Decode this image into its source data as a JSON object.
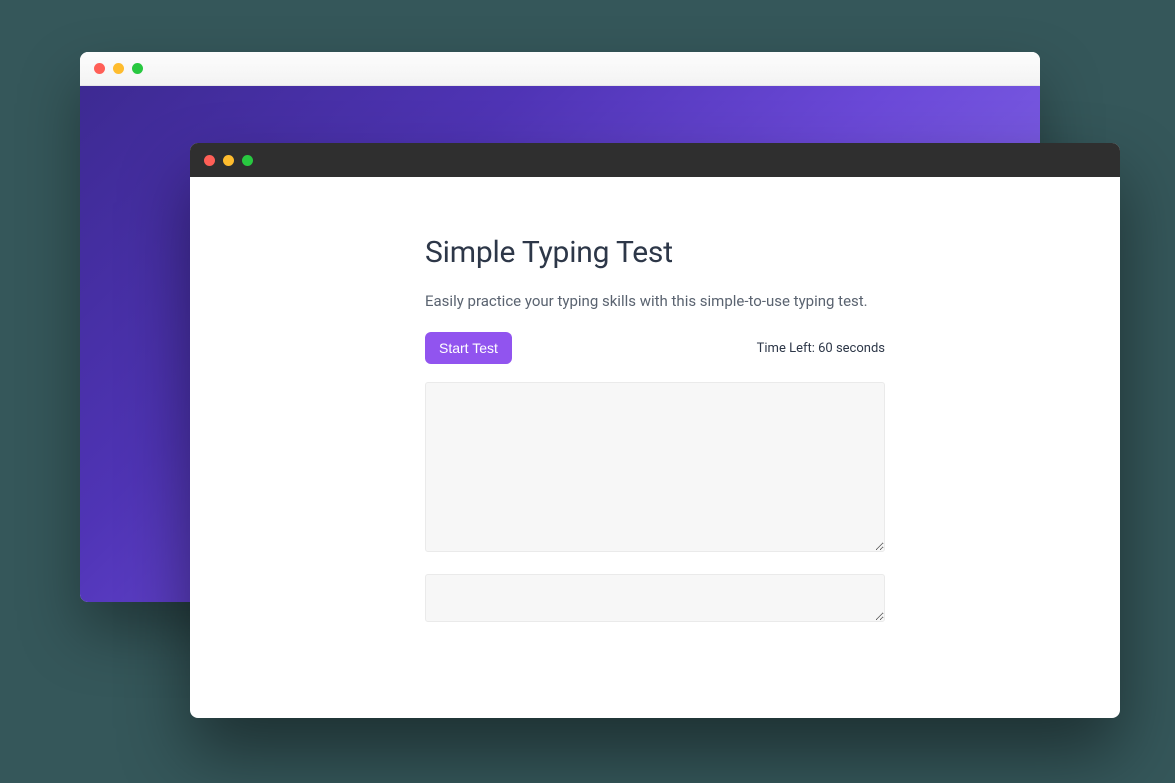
{
  "page": {
    "title": "Simple Typing Test",
    "subtitle": "Easily practice your typing skills with this simple-to-use typing test."
  },
  "controls": {
    "start_button_label": "Start Test",
    "time_left_label": "Time Left: 60 seconds"
  },
  "inputs": {
    "prompt_text": "",
    "typing_text": ""
  },
  "colors": {
    "accent": "#9154ef",
    "background_gradient_start": "#3d2a92",
    "background_gradient_end": "#9279f1"
  }
}
